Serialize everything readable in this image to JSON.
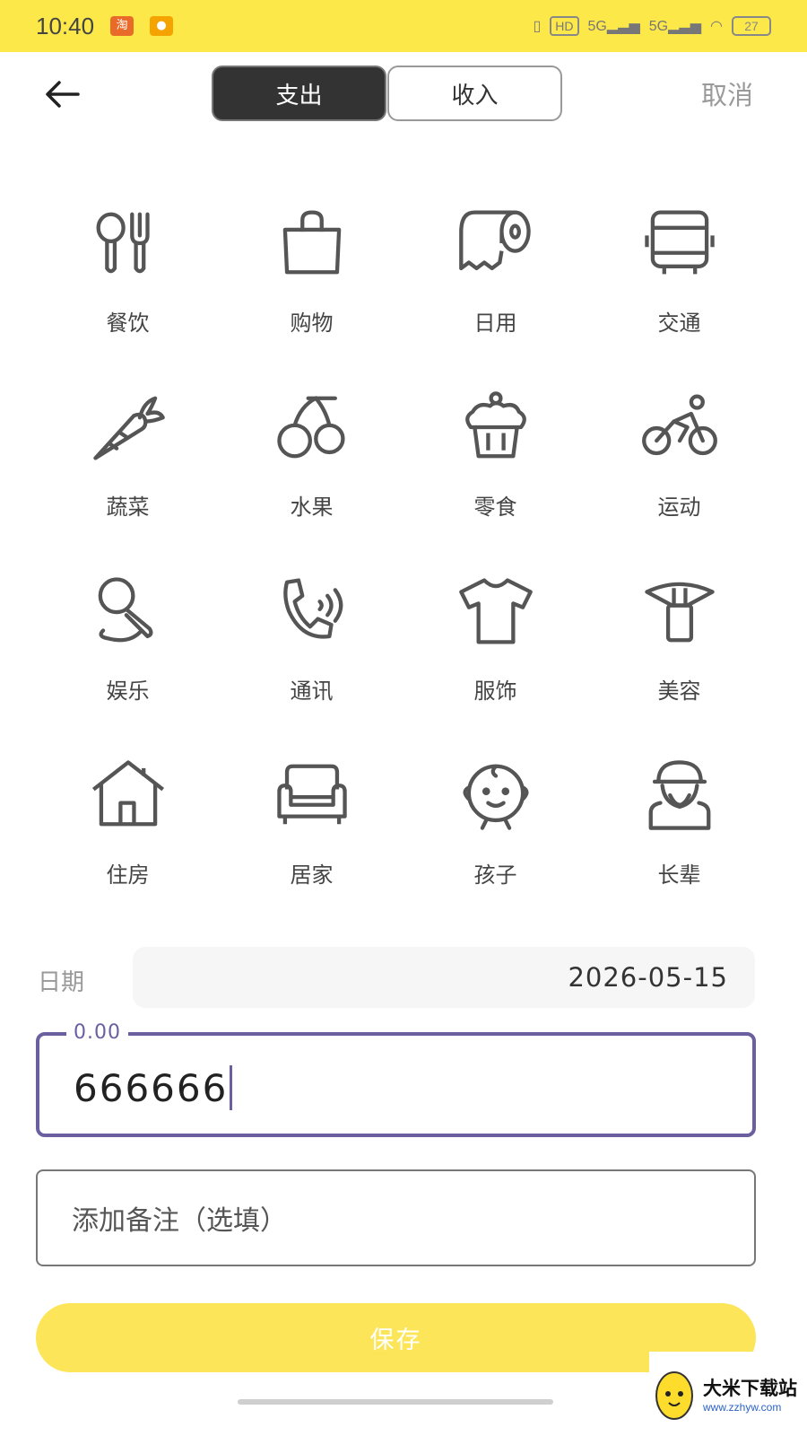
{
  "status_bar": {
    "time": "10:40",
    "hd_label": "HD",
    "net1": "5G",
    "net2": "5G",
    "battery": "27"
  },
  "nav": {
    "tab_expense": "支出",
    "tab_income": "收入",
    "cancel": "取消",
    "active_tab": "支出"
  },
  "categories": [
    {
      "label": "餐饮",
      "icon": "utensils-icon"
    },
    {
      "label": "购物",
      "icon": "shopping-bag-icon"
    },
    {
      "label": "日用",
      "icon": "tissue-roll-icon"
    },
    {
      "label": "交通",
      "icon": "bus-icon"
    },
    {
      "label": "蔬菜",
      "icon": "carrot-icon"
    },
    {
      "label": "水果",
      "icon": "cherry-icon"
    },
    {
      "label": "零食",
      "icon": "cupcake-icon"
    },
    {
      "label": "运动",
      "icon": "cyclist-icon"
    },
    {
      "label": "娱乐",
      "icon": "microphone-icon"
    },
    {
      "label": "通讯",
      "icon": "phone-call-icon"
    },
    {
      "label": "服饰",
      "icon": "tshirt-icon"
    },
    {
      "label": "美容",
      "icon": "lipstick-icon"
    },
    {
      "label": "住房",
      "icon": "house-icon"
    },
    {
      "label": "居家",
      "icon": "sofa-icon"
    },
    {
      "label": "孩子",
      "icon": "child-face-icon"
    },
    {
      "label": "长辈",
      "icon": "elder-icon"
    }
  ],
  "form": {
    "date_label": "日期",
    "date_value": "2026-05-15",
    "amount_placeholder": "0.00",
    "amount_value": "666666",
    "note_placeholder": "添加备注（选填）",
    "save_label": "保存"
  },
  "watermark": {
    "title": "大米下载站",
    "url": "www.zzhyw.com"
  },
  "colors": {
    "status_bar": "#fde84a",
    "save_button": "#fde55a",
    "accent": "#6b5fa0",
    "active_tab": "#333333"
  }
}
